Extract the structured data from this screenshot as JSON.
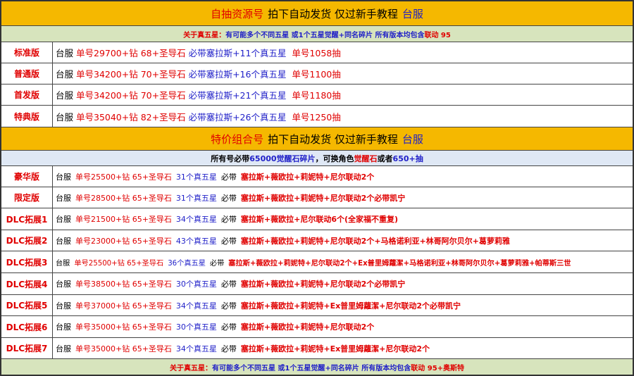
{
  "section1": {
    "title_red": "自抽资源号",
    "title_black": "拍下自动发货 仅过新手教程",
    "title_blue": "台服",
    "note": [
      {
        "t": "关于真五星：",
        "c": "r"
      },
      {
        "t": "有可能多个不同五星 或1个五星觉醒+同名碎片 所有版本均包含",
        "c": "b"
      },
      {
        "t": "联动 95",
        "c": "r"
      }
    ],
    "rows": [
      {
        "label": "标准版",
        "server": "台服",
        "price": "单号29700+钻 68+圣导石",
        "chars": "必带塞拉斯+11个真五星",
        "pulls": "单号1058抽"
      },
      {
        "label": "普通版",
        "server": "台服",
        "price": "单号34200+钻 70+圣导石",
        "chars": "必带塞拉斯+16个真五星",
        "pulls": "单号1100抽"
      },
      {
        "label": "首发版",
        "server": "台服",
        "price": "单号34200+钻 70+圣导石",
        "chars": "必带塞拉斯+21个真五星",
        "pulls": "单号1180抽"
      },
      {
        "label": "特典版",
        "server": "台服",
        "price": "单号35040+钻 82+圣导石",
        "chars": "必带塞拉斯+26个真五星",
        "pulls": "单号1250抽"
      }
    ]
  },
  "section2": {
    "title_red": "特价组合号",
    "title_black": "拍下自动发货 仅过新手教程",
    "title_blue": "台服",
    "note": [
      {
        "t": "所有号必带",
        "c": "k"
      },
      {
        "t": "65000觉醒石碎片",
        "c": "b"
      },
      {
        "t": "，可换角色",
        "c": "k"
      },
      {
        "t": "觉醒石",
        "c": "r"
      },
      {
        "t": "或者",
        "c": "k"
      },
      {
        "t": "650+抽",
        "c": "b"
      }
    ],
    "rows": [
      {
        "label": "豪华版",
        "server": "台服",
        "price": "单号25500+钻 65+圣导石",
        "stars": "31个真五星",
        "must": "必带",
        "chars": "塞拉斯+薇欧拉+莉妮特+尼尔联动2个"
      },
      {
        "label": "限定版",
        "server": "台服",
        "price": "单号28500+钻 65+圣导石",
        "stars": "31个真五星",
        "must": "必带",
        "chars": "塞拉斯+薇欧拉+莉妮特+尼尔联动2个必带凯宁"
      },
      {
        "label": "DLC拓展1",
        "server": "台服",
        "price": "单号21500+钻 65+圣导石",
        "stars": "34个真五星",
        "must": "必带",
        "chars": "塞拉斯+薇欧拉+尼尔联动6个(全家福不重复)"
      },
      {
        "label": "DLC拓展2",
        "server": "台服",
        "price": "单号23000+钻 65+圣导石",
        "stars": "43个真五星",
        "must": "必带",
        "chars": "塞拉斯+薇欧拉+莉妮特+尼尔联动2个+马格诺利亚+林哥阿尔贝尔+葛萝莉雅"
      },
      {
        "label": "DLC拓展3",
        "server": "台服",
        "price": "单号25500+钻 65+圣导石",
        "stars": "36个真五星",
        "must": "必带",
        "chars": "塞拉斯+薇欧拉+莉妮特+尼尔联动2个+Ex普里姆蘿潔+马格诺利亚+林哥阿尔贝尔+葛萝莉雅+帕蒂斯三世"
      },
      {
        "label": "DLC拓展4",
        "server": "台服",
        "price": "单号38500+钻 65+圣导石",
        "stars": "30个真五星",
        "must": "必带",
        "chars": "塞拉斯+薇欧拉+莉妮特+尼尔联动2个必带凯宁"
      },
      {
        "label": "DLC拓展5",
        "server": "台服",
        "price": "单号37000+钻 65+圣导石",
        "stars": "34个真五星",
        "must": "必带",
        "chars": "塞拉斯+薇欧拉+莉妮特+Ex普里姆蘿潔+尼尔联动2个必带凯宁"
      },
      {
        "label": "DLC拓展6",
        "server": "台服",
        "price": "单号35000+钻 65+圣导石",
        "stars": "30个真五星",
        "must": "必带",
        "chars": "塞拉斯+薇欧拉+莉妮特+尼尔联动2个"
      },
      {
        "label": "DLC拓展7",
        "server": "台服",
        "price": "单号35000+钻 65+圣导石",
        "stars": "34个真五星",
        "must": "必带",
        "chars": "塞拉斯+薇欧拉+莉妮特+Ex普里姆蘿潔+尼尔联动2个"
      }
    ]
  },
  "footer_note": [
    {
      "t": "关于真五星：",
      "c": "r"
    },
    {
      "t": "有可能多个不同五星 或1个五星觉醒+同名碎片 所有版本均包含",
      "c": "b"
    },
    {
      "t": "联动 95+奥斯特",
      "c": "r"
    }
  ]
}
